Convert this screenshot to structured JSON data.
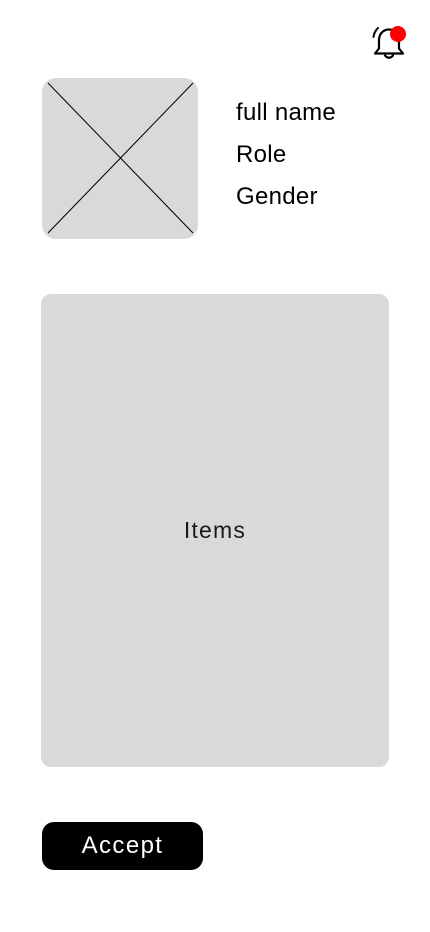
{
  "header": {
    "notification_icon": "bell-icon",
    "notification_badge_color": "#ff0000"
  },
  "profile": {
    "avatar_icon": "image-placeholder-icon",
    "full_name": "full name",
    "role": "Role",
    "gender": "Gender"
  },
  "items_panel": {
    "label": "Items",
    "background_color": "#d9d9d9"
  },
  "actions": {
    "accept_label": "Accept",
    "accept_bg_color": "#000000"
  }
}
